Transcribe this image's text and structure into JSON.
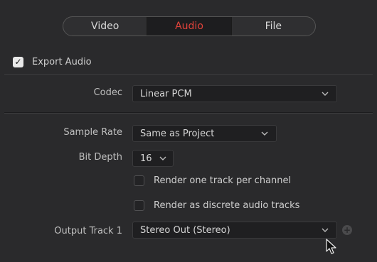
{
  "tabs": [
    {
      "label": "Video",
      "active": false
    },
    {
      "label": "Audio",
      "active": true
    },
    {
      "label": "File",
      "active": false
    }
  ],
  "export_audio": {
    "label": "Export Audio",
    "checked": true
  },
  "codec": {
    "label": "Codec",
    "value": "Linear PCM"
  },
  "sample_rate": {
    "label": "Sample Rate",
    "value": "Same as Project"
  },
  "bit_depth": {
    "label": "Bit Depth",
    "value": "16"
  },
  "render_one_track": {
    "label": "Render one track per channel",
    "checked": false
  },
  "render_discrete": {
    "label": "Render as discrete audio tracks",
    "checked": false
  },
  "output_track": {
    "label": "Output Track 1",
    "value": "Stereo Out (Stereo)"
  },
  "colors": {
    "accent": "#e2433b",
    "background": "#2a2a2c"
  },
  "icons": {
    "check": "checkmark-icon",
    "chevron": "chevron-down-icon",
    "plus": "plus-icon",
    "cursor": "mouse-pointer-icon"
  }
}
